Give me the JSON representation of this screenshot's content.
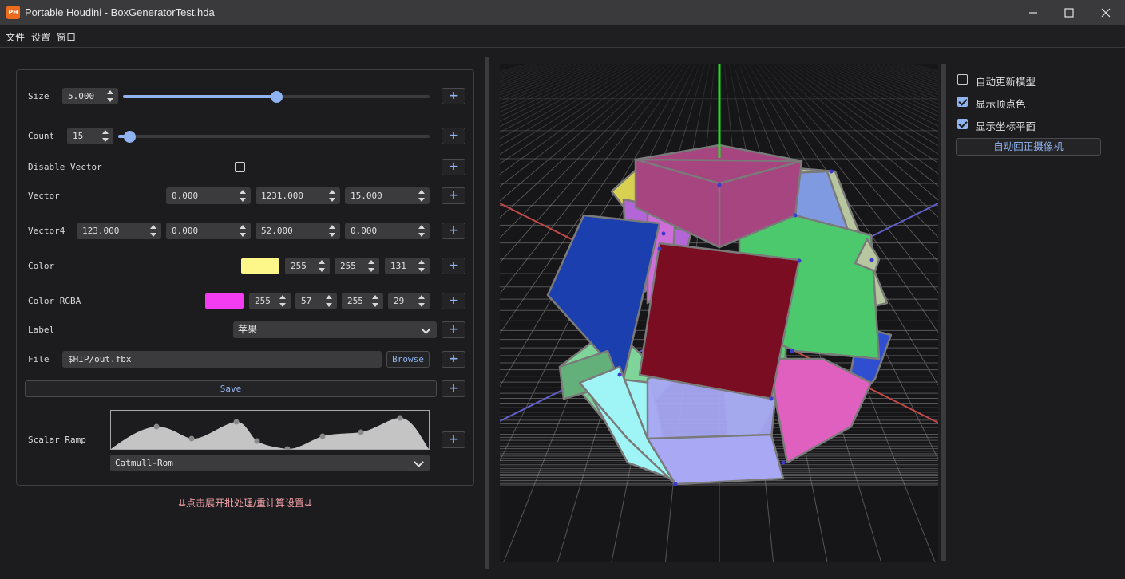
{
  "window": {
    "app_icon": "PH",
    "title": "Portable Houdini - BoxGeneratorTest.hda",
    "minimize_icon": "minimize-icon",
    "maximize_icon": "maximize-icon",
    "close_icon": "close-icon"
  },
  "menu": [
    "文件",
    "设置",
    "窗口"
  ],
  "params": {
    "size": {
      "label": "Size",
      "value": "5.000",
      "slider_fraction": 0.5
    },
    "count": {
      "label": "Count",
      "value": "15",
      "slider_fraction": 0.0
    },
    "disable_vector": {
      "label": "Disable Vector",
      "checked": false
    },
    "vector": {
      "label": "Vector",
      "values": [
        "0.000",
        "1231.000",
        "15.000"
      ]
    },
    "vector4": {
      "label": "Vector4",
      "values": [
        "123.000",
        "0.000",
        "52.000",
        "0.000"
      ]
    },
    "color": {
      "label": "Color",
      "swatch": "#fdf78a",
      "values": [
        "255",
        "255",
        "131"
      ]
    },
    "color_rgba": {
      "label": "Color RGBA",
      "swatch": "#f43cf3",
      "values": [
        "255",
        "57",
        "255",
        "29"
      ]
    },
    "label": {
      "label": "Label",
      "value": "苹果"
    },
    "file": {
      "label": "File",
      "value": "$HIP/out.fbx",
      "browse": "Browse"
    },
    "save": "Save",
    "scalar_ramp": {
      "label": "Scalar Ramp",
      "interpolation": "Catmull-Rom"
    },
    "add_icon": "+"
  },
  "expand_hint": "⇊点击展开批处理/重计算设置⇊",
  "right_panel": {
    "auto_update": {
      "label": "自动更新模型",
      "checked": false
    },
    "show_vertex_color": {
      "label": "显示顶点色",
      "checked": true
    },
    "show_grid": {
      "label": "显示坐标平面",
      "checked": true
    },
    "reset_camera": "自动回正摄像机"
  },
  "colors": {
    "accent": "#8fb2f0",
    "hint": "#f0a0a8"
  }
}
